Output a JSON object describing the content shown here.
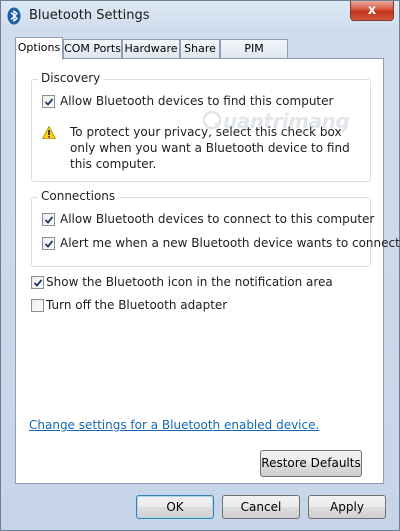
{
  "window": {
    "title": "Bluetooth Settings",
    "close_label": "x"
  },
  "tabs": [
    {
      "label": "Options",
      "active": true
    },
    {
      "label": "COM Ports",
      "active": false
    },
    {
      "label": "Hardware",
      "active": false
    },
    {
      "label": "Share",
      "active": false
    },
    {
      "label": "PIM Interface",
      "active": false
    }
  ],
  "discovery": {
    "title": "Discovery",
    "allow_find_label": "Allow Bluetooth devices to find this computer",
    "allow_find_checked": true,
    "warning_text": "To protect your privacy, select this check box only when you want a Bluetooth device to find this computer."
  },
  "connections": {
    "title": "Connections",
    "allow_connect_label": "Allow Bluetooth devices to connect to this computer",
    "allow_connect_checked": true,
    "alert_label": "Alert me when a new Bluetooth device wants to connect",
    "alert_checked": true
  },
  "options": {
    "show_icon_label": "Show the Bluetooth icon in the notification area",
    "show_icon_checked": true,
    "turn_off_label": "Turn off the Bluetooth adapter",
    "turn_off_checked": false
  },
  "link_text": "Change settings for a Bluetooth enabled device.",
  "buttons": {
    "restore": "Restore Defaults",
    "ok": "OK",
    "cancel": "Cancel",
    "apply": "Apply"
  },
  "watermark": "uantrimang"
}
